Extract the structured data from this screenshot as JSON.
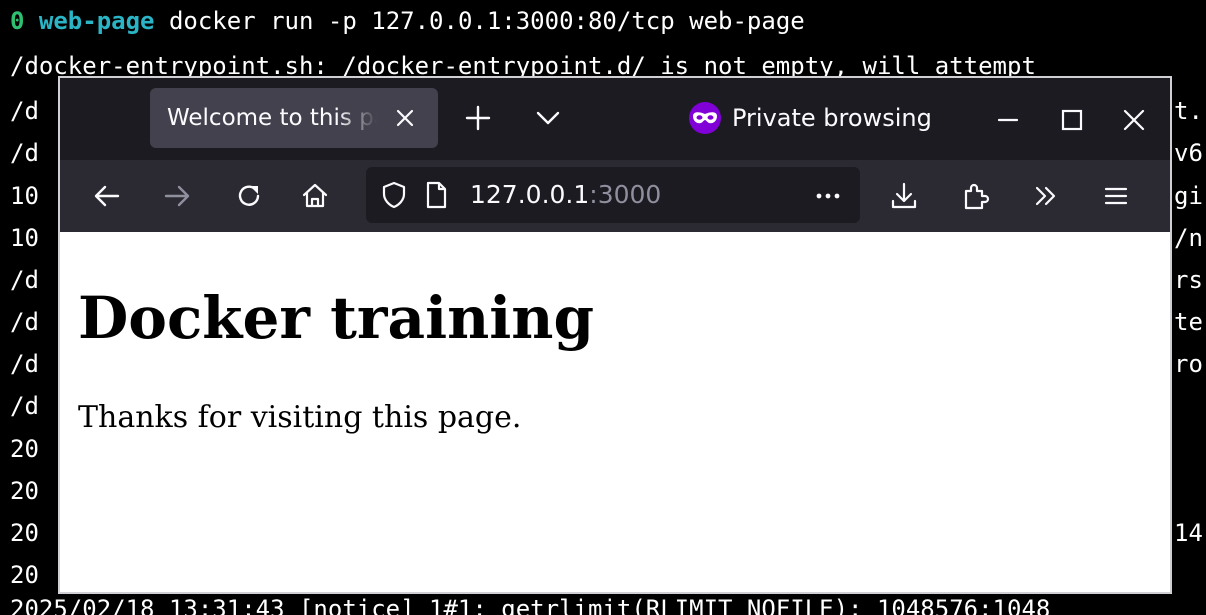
{
  "terminal": {
    "prompt": {
      "status": "0",
      "dir": "web-page",
      "command": "docker run -p 127.0.0.1:3000:80/tcp web-page"
    },
    "line2": "/docker-entrypoint.sh: /docker-entrypoint.d/ is not empty, will attempt",
    "left_fragments": [
      "/d",
      "/d",
      "10",
      "10",
      "/d",
      "/d",
      "/d",
      "/d",
      "20",
      "20",
      "20",
      "20"
    ],
    "right_fragments": [
      "t.",
      "v6",
      "gi",
      "/n",
      "rs",
      "te",
      "ro",
      "",
      "",
      "",
      "14",
      ""
    ],
    "last_line": "2025/02/18 13:31:43 [notice] 1#1: getrlimit(RLIMIT_NOFILE): 1048576:1048"
  },
  "browser": {
    "tab": {
      "title": "Welcome to this page"
    },
    "private_label": "Private browsing",
    "url": {
      "host": "127.0.0.1",
      "port": ":3000"
    },
    "icons": {
      "tab_close": "close-icon",
      "new_tab": "plus-icon",
      "tab_list": "chevron-down-icon",
      "private": "private-mask-icon",
      "minimize": "minimize-icon",
      "maximize": "maximize-icon",
      "close_window": "close-icon",
      "back": "back-arrow-icon",
      "forward": "forward-arrow-icon",
      "reload": "reload-icon",
      "home": "home-icon",
      "tracking": "shield-icon",
      "page_info": "page-icon",
      "page_actions": "more-icon",
      "downloads": "download-icon",
      "extensions": "puzzle-icon",
      "overflow": "chevrons-right-icon",
      "menu": "hamburger-menu-icon"
    },
    "colors": {
      "tabbar_bg": "#1c1b22",
      "toolbar_bg": "#2b2a33",
      "active_tab_bg": "#42414d",
      "private_purple": "#8000d7"
    }
  },
  "page": {
    "heading": "Docker training",
    "paragraph": "Thanks for visiting this page."
  }
}
